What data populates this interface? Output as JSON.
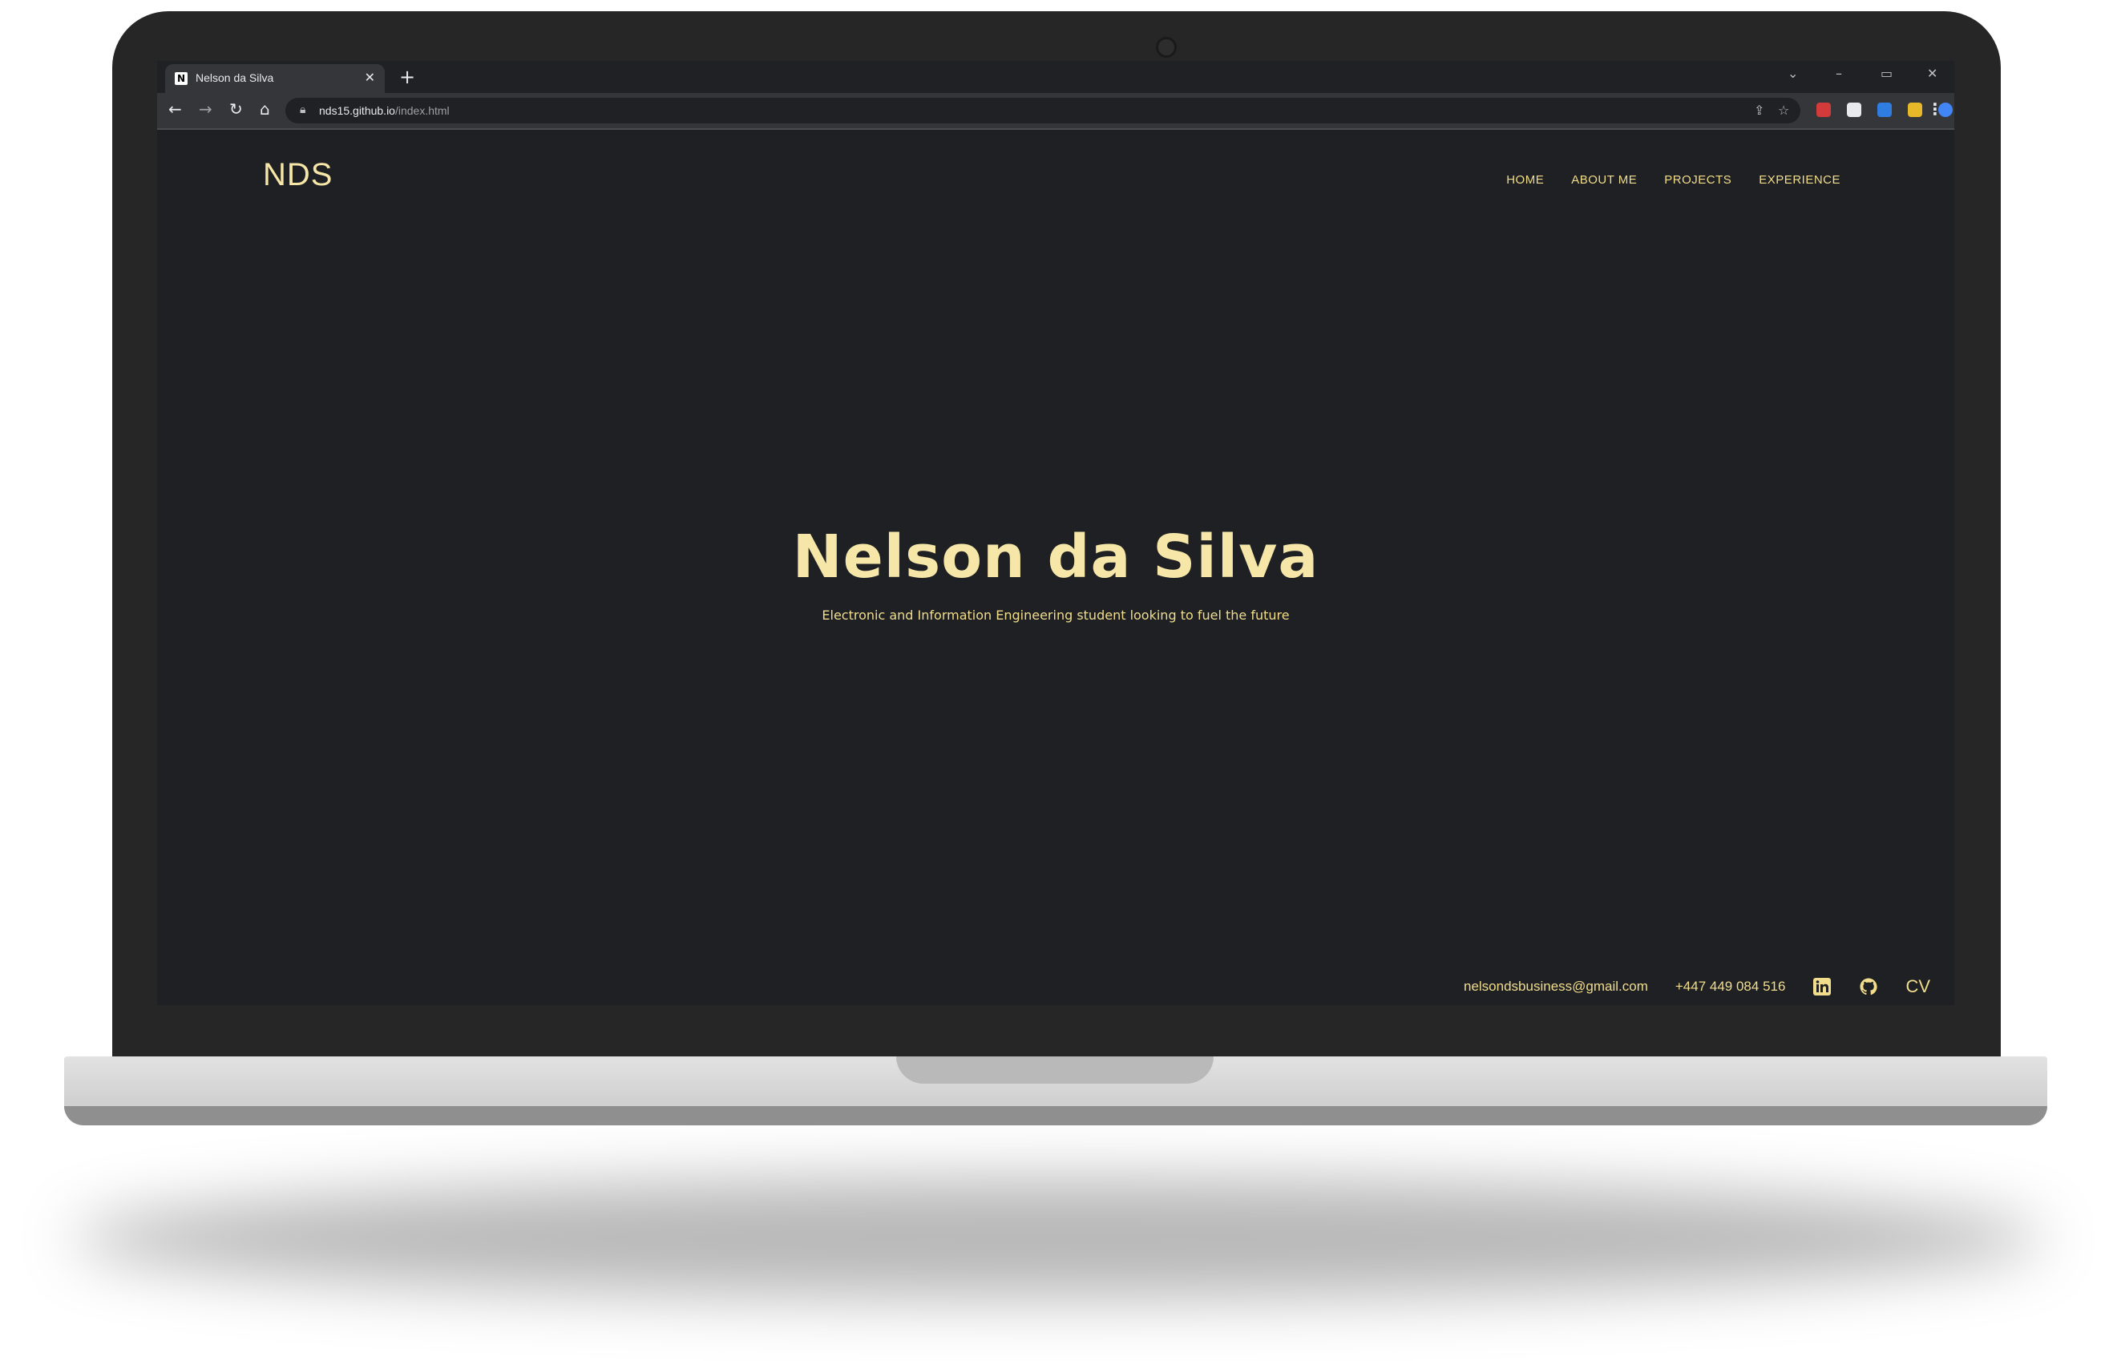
{
  "browser": {
    "tab_title": "Nelson da Silva",
    "tab_favicon": "N",
    "url_host": "nds15.github.io",
    "url_path": "/index.html",
    "new_tab_icon": "+",
    "close_icon": "✕"
  },
  "site": {
    "logo": "NDS",
    "nav": [
      "HOME",
      "ABOUT ME",
      "PROJECTS",
      "EXPERIENCE"
    ],
    "hero_title": "Nelson da Silva",
    "hero_subtitle": "Electronic and Information Engineering student looking to fuel the future",
    "footer": {
      "email": "nelsondsbusiness@gmail.com",
      "phone": "+447 449 084 516",
      "linkedin_icon": "linkedin-icon",
      "github_icon": "github-icon",
      "cv": "CV"
    }
  },
  "colors": {
    "accent": "#f1dd8c",
    "background": "#1f2023",
    "chrome": "#35363a"
  }
}
